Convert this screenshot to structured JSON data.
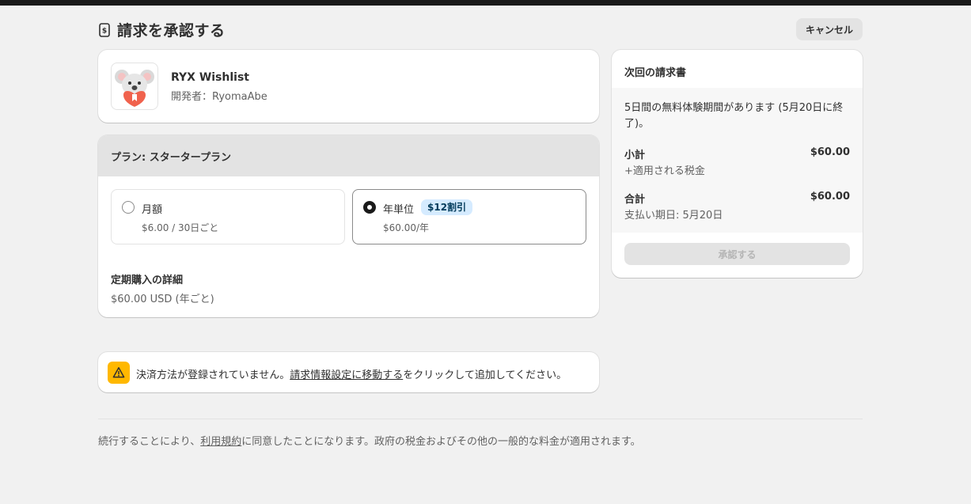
{
  "page": {
    "title": "請求を承認する",
    "cancel_label": "キャンセル"
  },
  "app": {
    "name": "RYX Wishlist",
    "developer": "開発者：RyomaAbe"
  },
  "plan": {
    "header": "プラン: スタータープラン",
    "options": [
      {
        "label": "月額",
        "price": "$6.00 / 30日ごと",
        "selected": false
      },
      {
        "label": "年単位",
        "badge": "$12割引",
        "price": "$60.00/年",
        "selected": true
      }
    ],
    "subscription_title": "定期購入の詳細",
    "subscription_value": "$60.00 USD (年ごと)"
  },
  "warning": {
    "before": "決済方法が登録されていません。",
    "link": "請求情報設定に移動する",
    "after": "をクリックして追加してください。"
  },
  "invoice": {
    "title": "次回の請求書",
    "trial": "5日間の無料体験期間があります (5月20日に終了)。",
    "subtotal_label": "小計",
    "subtotal_amount": "$60.00",
    "tax_note": "+適用される税金",
    "total_label": "合計",
    "total_amount": "$60.00",
    "due_date": "支払い期日: 5月20日",
    "approve_label": "承認する"
  },
  "footer": {
    "before": "続行することにより、",
    "link": "利用規約",
    "after": "に同意したことになります。政府の税金およびその他の一般的な料金が適用されます。"
  },
  "colors": {
    "background": "#f1f1f1",
    "topbar": "#1a1a1a",
    "warning": "#ffb800",
    "badge_bg": "#d5ebff"
  },
  "icons": {
    "title": "receipt-icon",
    "app": "koala-app-icon",
    "warning": "alert-triangle-icon"
  }
}
